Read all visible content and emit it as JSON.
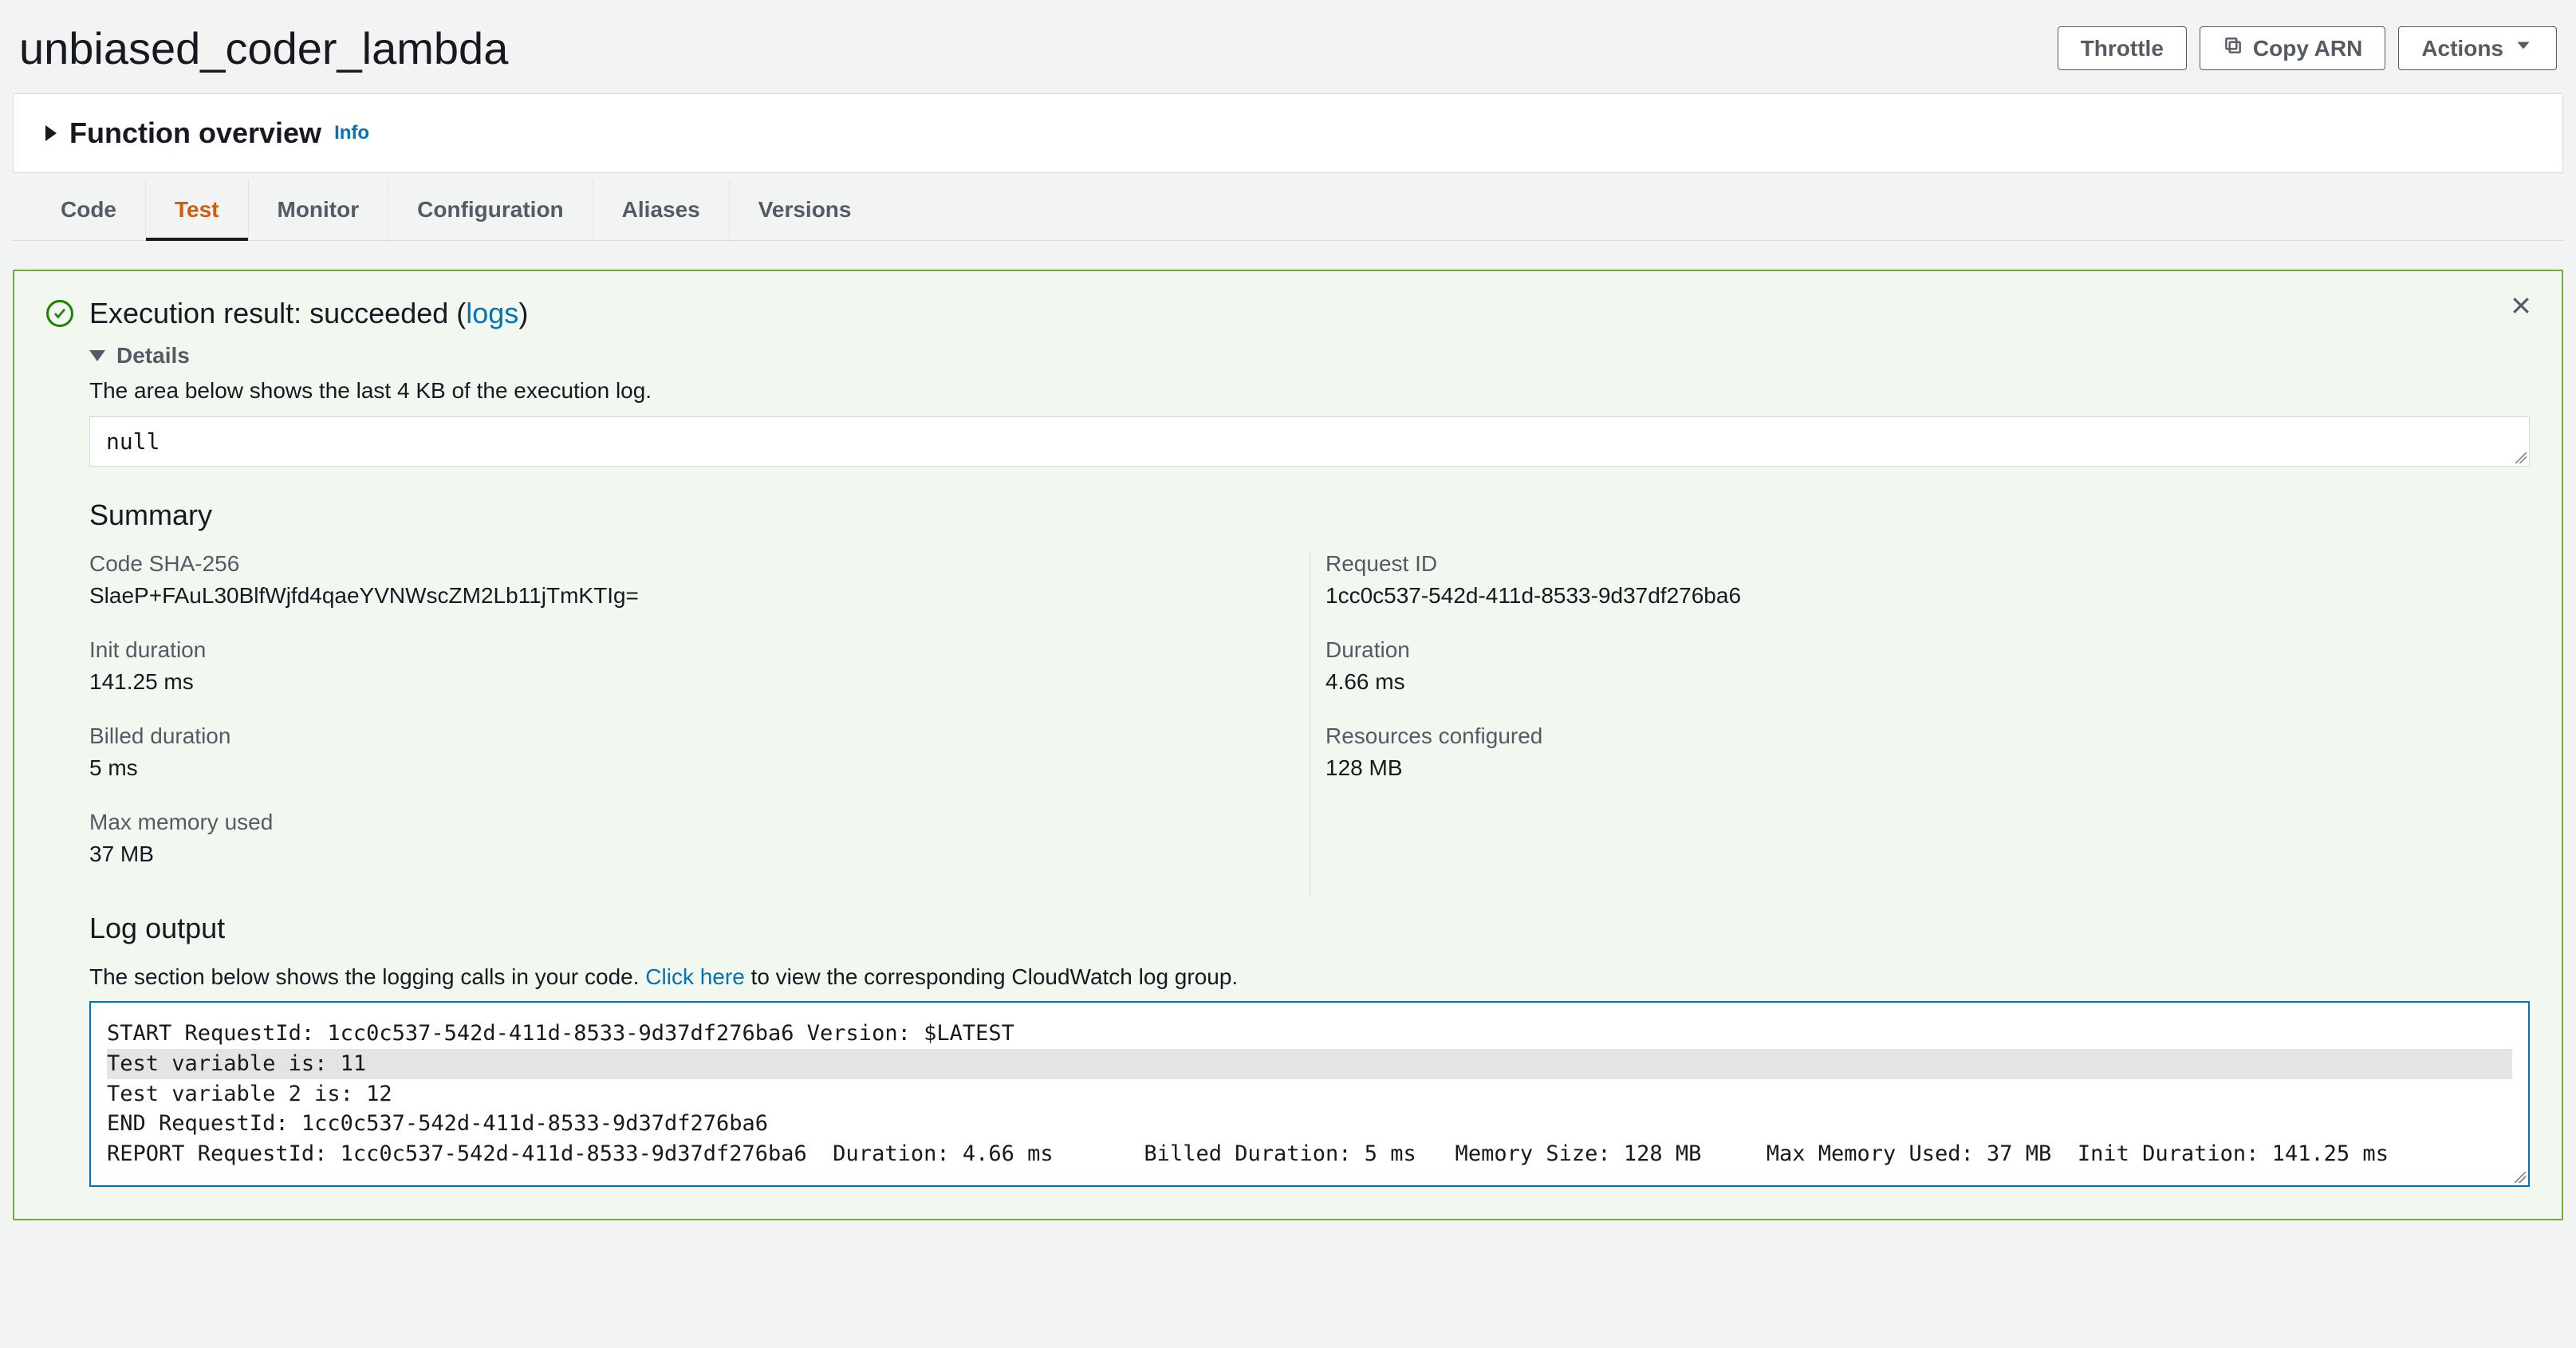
{
  "header": {
    "title": "unbiased_coder_lambda",
    "throttle": "Throttle",
    "copy_arn": "Copy ARN",
    "actions": "Actions"
  },
  "overview": {
    "title": "Function overview",
    "info": "Info"
  },
  "tabs": {
    "code": "Code",
    "test": "Test",
    "monitor": "Monitor",
    "configuration": "Configuration",
    "aliases": "Aliases",
    "versions": "Versions"
  },
  "result": {
    "prefix": "Execution result: succeeded (",
    "logs": "logs",
    "suffix": ")",
    "details": "Details",
    "hint": "The area below shows the last 4 KB of the execution log.",
    "null_value": "null"
  },
  "summary": {
    "title": "Summary",
    "code_sha_label": "Code SHA-256",
    "code_sha_value": "SlaeP+FAuL30BlfWjfd4qaeYVNWscZM2Lb11jTmKTIg=",
    "request_id_label": "Request ID",
    "request_id_value": "1cc0c537-542d-411d-8533-9d37df276ba6",
    "init_duration_label": "Init duration",
    "init_duration_value": "141.25 ms",
    "duration_label": "Duration",
    "duration_value": "4.66 ms",
    "billed_label": "Billed duration",
    "billed_value": "5 ms",
    "resources_label": "Resources configured",
    "resources_value": "128 MB",
    "max_mem_label": "Max memory used",
    "max_mem_value": "37 MB"
  },
  "log": {
    "title": "Log output",
    "desc_prefix": "The section below shows the logging calls in your code. ",
    "click_here": "Click here",
    "desc_suffix": " to view the corresponding CloudWatch log group.",
    "lines": [
      "START RequestId: 1cc0c537-542d-411d-8533-9d37df276ba6 Version: $LATEST",
      "Test variable is: 11",
      "Test variable 2 is: 12",
      "END RequestId: 1cc0c537-542d-411d-8533-9d37df276ba6",
      "REPORT RequestId: 1cc0c537-542d-411d-8533-9d37df276ba6  Duration: 4.66 ms       Billed Duration: 5 ms   Memory Size: 128 MB     Max Memory Used: 37 MB  Init Duration: 141.25 ms"
    ]
  }
}
